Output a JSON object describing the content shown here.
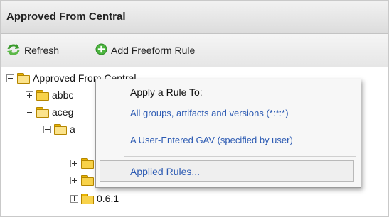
{
  "panel": {
    "title": "Approved From Central"
  },
  "toolbar": {
    "refresh_label": "Refresh",
    "refresh_icon": "refresh-arrows-icon",
    "add_label": "Add Freeform Rule",
    "add_icon": "green-plus-circle-icon"
  },
  "tree": {
    "root": {
      "label": "Approved From Central",
      "expanded": true
    },
    "nodes": [
      {
        "label": "abbc",
        "expanded": false
      },
      {
        "label": "aceg",
        "expanded": true
      },
      {
        "label": "a",
        "expanded": true
      },
      {
        "label": "",
        "expanded": false
      },
      {
        "label": "",
        "expanded": false
      },
      {
        "label": "0.6.1",
        "expanded": false
      }
    ]
  },
  "context_menu": {
    "heading": "Apply a Rule To:",
    "items": [
      "All groups, artifacts and versions (*:*:*)",
      "A User-Entered GAV (specified by user)"
    ],
    "applied_label": "Applied Rules..."
  },
  "colors": {
    "link": "#2d5bb3",
    "folder": "#f8d24a",
    "header_bg": "#dcdcdc"
  }
}
